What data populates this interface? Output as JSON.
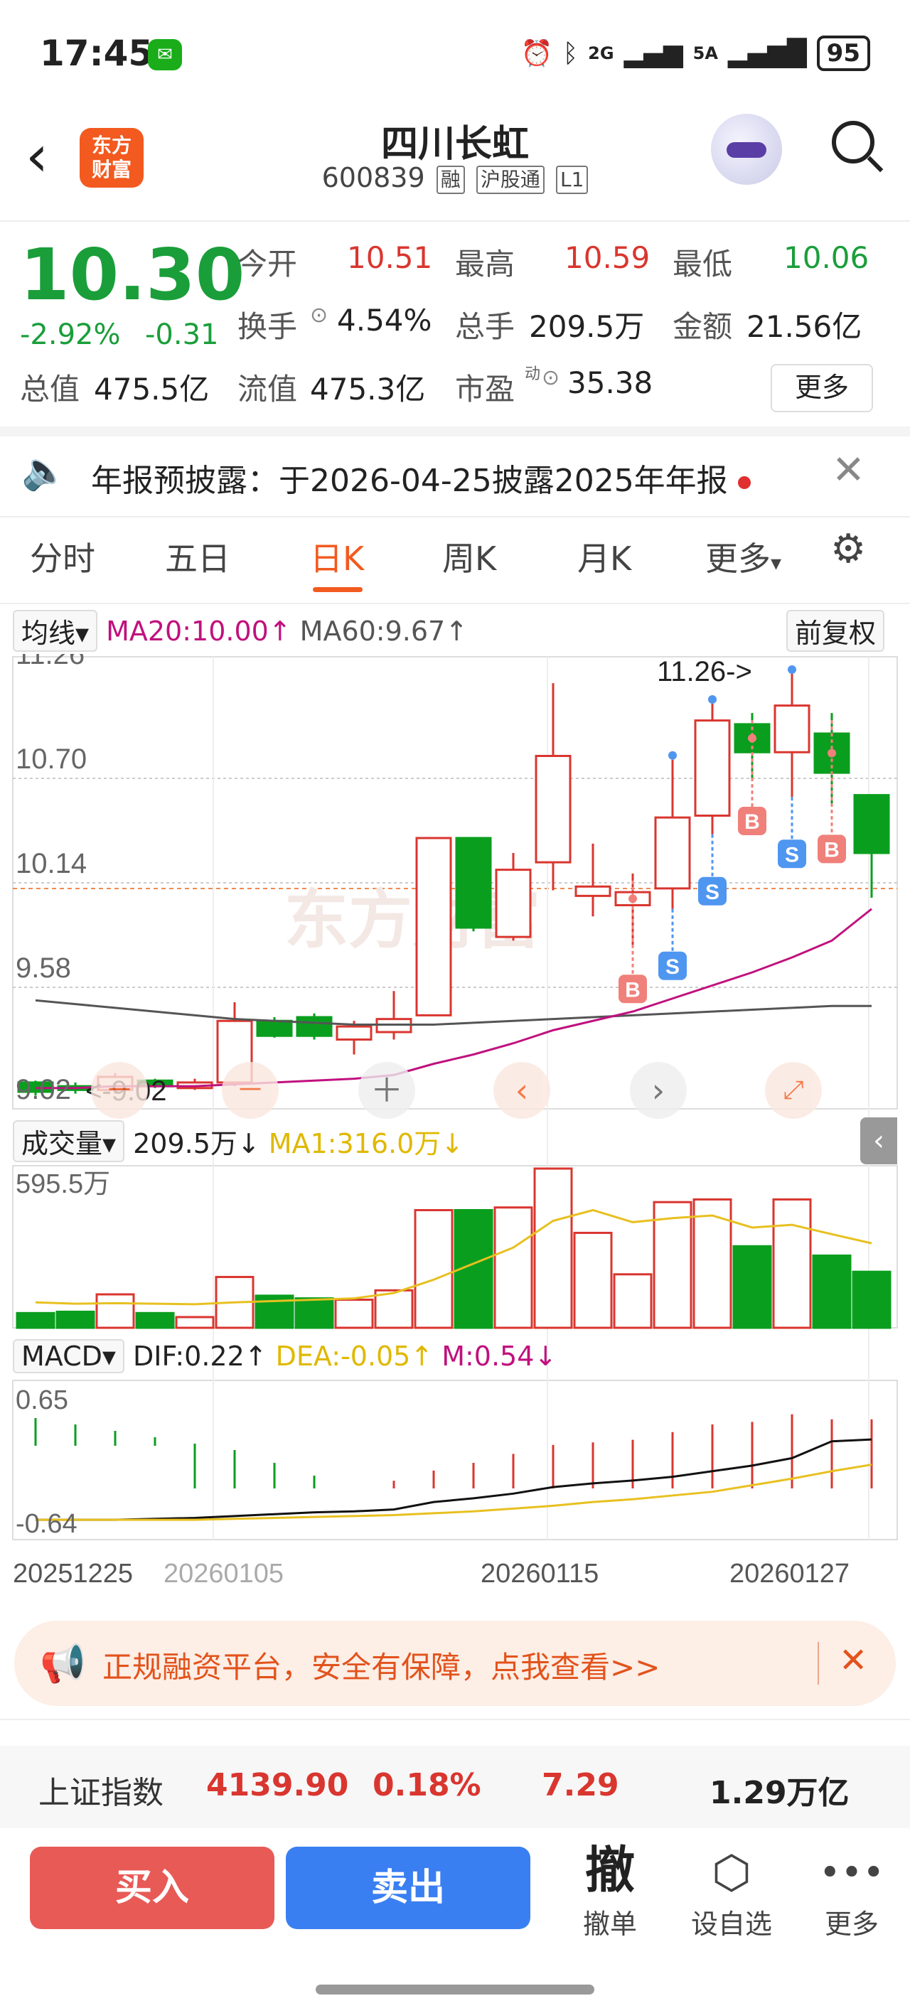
{
  "status": {
    "time": "17:45",
    "battery": "95",
    "network": "2G",
    "network2": "5A"
  },
  "header": {
    "logo_line1": "东方",
    "logo_line2": "财富",
    "title": "四川长虹",
    "code": "600839",
    "tags": [
      "融",
      "沪股通",
      "L1"
    ]
  },
  "quote": {
    "price": "10.30",
    "change_pct": "-2.92%",
    "change": "-0.31",
    "row1": [
      {
        "label": "今开",
        "value": "10.51"
      },
      {
        "label": "最高",
        "value": "10.59"
      },
      {
        "label": "最低",
        "value": "10.06"
      }
    ],
    "row2": [
      {
        "label": "换手",
        "value": "4.54%"
      },
      {
        "label": "总手",
        "value": "209.5万"
      },
      {
        "label": "金额",
        "value": "21.56亿"
      }
    ],
    "row3": [
      {
        "label": "总值",
        "value": "475.5亿"
      },
      {
        "label": "流值",
        "value": "475.3亿"
      },
      {
        "label": "市盈",
        "sup": "动",
        "value": "35.38"
      }
    ],
    "more": "更多"
  },
  "notice": {
    "text": "年报预披露：于2026-04-25披露2025年年报"
  },
  "tabs": [
    "分时",
    "五日",
    "日K",
    "周K",
    "月K",
    "更多"
  ],
  "active_tab": "日K",
  "kline": {
    "ma_select": "均线",
    "ma20": "MA20:10.00↑",
    "ma60": "MA60:9.67↑",
    "adjust": "前复权",
    "y_labels": [
      "11.26",
      "10.70",
      "10.14",
      "9.58",
      "9.02"
    ],
    "high_annotation": "11.26->",
    "low_annotation": "<-9.02",
    "colors": {
      "up": "#d9362f",
      "down": "#0a9e1e",
      "ma20": "#c0117e",
      "ma60": "#555555"
    }
  },
  "volume": {
    "select": "成交量",
    "value": "209.5万↓",
    "ma1": "MA1:316.0万↓",
    "y_label": "595.5万"
  },
  "macd": {
    "select": "MACD",
    "dif": "DIF:0.22↑",
    "dea": "DEA:-0.05↑",
    "m": "M:0.54↓",
    "y_top": "0.65",
    "y_bottom": "-0.64"
  },
  "x_dates": [
    "20251225",
    "20260105",
    "20260115",
    "20260127"
  ],
  "ad": {
    "text": "正规融资平台，安全有保障，点我查看>>"
  },
  "index": {
    "name": "上证指数",
    "value": "4139.90",
    "pct": "0.18%",
    "change": "7.29",
    "amount": "1.29万亿"
  },
  "actions": {
    "buy": "买入",
    "sell": "卖出",
    "cancel_big": "撤",
    "cancel": "撤单",
    "watch": "设自选",
    "more": "更多"
  },
  "chart_data": {
    "type": "candlestick",
    "candles": [
      {
        "open": 9.07,
        "close": 9.02,
        "high": 9.08,
        "low": 9.0
      },
      {
        "open": 9.05,
        "close": 9.03,
        "high": 9.07,
        "low": 9.01
      },
      {
        "open": 9.03,
        "close": 9.1,
        "high": 9.12,
        "low": 9.01
      },
      {
        "open": 9.08,
        "close": 9.05,
        "high": 9.09,
        "low": 9.04
      },
      {
        "open": 9.04,
        "close": 9.07,
        "high": 9.09,
        "low": 9.03
      },
      {
        "open": 9.07,
        "close": 9.4,
        "high": 9.5,
        "low": 9.05
      },
      {
        "open": 9.4,
        "close": 9.32,
        "high": 9.42,
        "low": 9.31
      },
      {
        "open": 9.42,
        "close": 9.32,
        "high": 9.44,
        "low": 9.3
      },
      {
        "open": 9.3,
        "close": 9.37,
        "high": 9.4,
        "low": 9.22
      },
      {
        "open": 9.34,
        "close": 9.41,
        "high": 9.56,
        "low": 9.3
      },
      {
        "open": 9.43,
        "close": 10.38,
        "high": 10.38,
        "low": 9.43
      },
      {
        "open": 10.38,
        "close": 9.9,
        "high": 10.38,
        "low": 9.88
      },
      {
        "open": 9.85,
        "close": 10.21,
        "high": 10.3,
        "low": 9.83
      },
      {
        "open": 10.25,
        "close": 10.82,
        "high": 11.21,
        "low": 10.1
      },
      {
        "open": 10.07,
        "close": 10.12,
        "high": 10.35,
        "low": 9.96
      },
      {
        "open": 10.02,
        "close": 10.09,
        "high": 10.19,
        "low": 9.8
      },
      {
        "open": 10.11,
        "close": 10.49,
        "high": 10.8,
        "low": 10.0
      },
      {
        "open": 10.5,
        "close": 11.01,
        "high": 11.1,
        "low": 10.4
      },
      {
        "open": 10.99,
        "close": 10.84,
        "high": 11.05,
        "low": 10.7
      },
      {
        "open": 10.84,
        "close": 11.09,
        "high": 11.26,
        "low": 10.6
      },
      {
        "open": 10.94,
        "close": 10.73,
        "high": 11.05,
        "low": 10.55
      },
      {
        "open": 10.61,
        "close": 10.3,
        "high": 10.59,
        "low": 10.06
      }
    ],
    "ma20": [
      9.04,
      9.04,
      9.05,
      9.05,
      9.05,
      9.06,
      9.07,
      9.08,
      9.09,
      9.11,
      9.17,
      9.22,
      9.28,
      9.35,
      9.4,
      9.45,
      9.52,
      9.59,
      9.66,
      9.74,
      9.83,
      10.0
    ],
    "ma60": [
      9.51,
      9.49,
      9.47,
      9.45,
      9.43,
      9.41,
      9.4,
      9.39,
      9.38,
      9.38,
      9.38,
      9.39,
      9.4,
      9.41,
      9.42,
      9.43,
      9.44,
      9.45,
      9.46,
      9.47,
      9.48,
      9.48
    ],
    "volume_wan": [
      55,
      60,
      125,
      55,
      40,
      190,
      120,
      110,
      105,
      140,
      440,
      440,
      450,
      595.5,
      355,
      200,
      470,
      480,
      305,
      480,
      270,
      209.5
    ],
    "volume_ma1_wan": [
      95,
      90,
      92,
      90,
      88,
      95,
      100,
      105,
      110,
      130,
      180,
      240,
      300,
      400,
      440,
      395,
      410,
      420,
      375,
      385,
      350,
      316
    ],
    "macd_m": [
      -0.55,
      -0.5,
      -0.45,
      -0.4,
      -0.35,
      -0.3,
      -0.2,
      -0.1,
      0.0,
      0.06,
      0.14,
      0.2,
      0.27,
      0.34,
      0.36,
      0.38,
      0.44,
      0.5,
      0.52,
      0.58,
      0.54,
      0.54
    ],
    "dif": [
      -0.64,
      -0.64,
      -0.64,
      -0.63,
      -0.62,
      -0.6,
      -0.58,
      -0.56,
      -0.55,
      -0.53,
      -0.45,
      -0.41,
      -0.36,
      -0.29,
      -0.25,
      -0.22,
      -0.18,
      -0.12,
      -0.06,
      0.02,
      0.2,
      0.22
    ],
    "dea": [
      -0.64,
      -0.64,
      -0.64,
      -0.64,
      -0.64,
      -0.63,
      -0.62,
      -0.61,
      -0.6,
      -0.59,
      -0.57,
      -0.55,
      -0.52,
      -0.49,
      -0.45,
      -0.42,
      -0.38,
      -0.34,
      -0.27,
      -0.2,
      -0.12,
      -0.05
    ],
    "signals": [
      {
        "index": 15,
        "type": "B"
      },
      {
        "index": 16,
        "type": "S"
      },
      {
        "index": 17,
        "type": "S"
      },
      {
        "index": 18,
        "type": "B"
      },
      {
        "index": 19,
        "type": "S"
      },
      {
        "index": 20,
        "type": "B"
      }
    ],
    "ylim": [
      9.02,
      11.26
    ]
  }
}
